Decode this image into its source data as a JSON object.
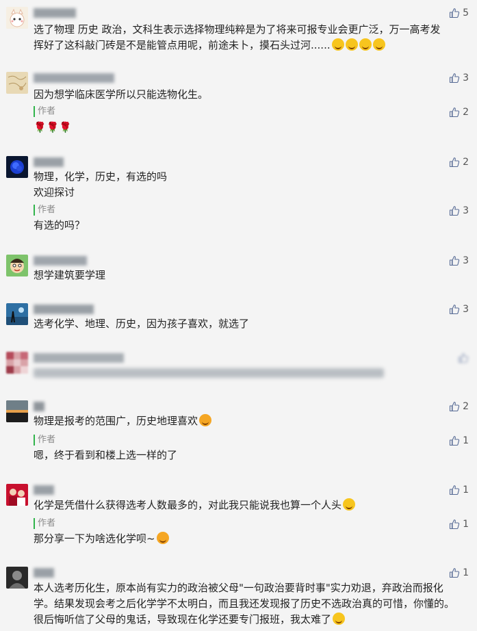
{
  "comments": [
    {
      "avatar": "cat-avatar",
      "likes": "5",
      "text": "选了物理 历史 政治，文科生表示选择物理纯粹是为了将来可报专业会更广泛，万一高考发挥好了这科敲门砖是不是能管点用呢，前途未卜，摸石头过河......",
      "emojis": [
        "crying-emoji",
        "crying-emoji",
        "laughing-emoji",
        "laughing-emoji"
      ]
    },
    {
      "avatar": "map-avatar",
      "likes": "3",
      "text": "因为想学临床医学所以只能选物化生。",
      "reply": {
        "tag": "作者",
        "likes": "2",
        "text": "🌹🌹🌹"
      }
    },
    {
      "avatar": "blue-rose-avatar",
      "likes": "2",
      "text": "物理，化学，历史，有选的吗\n欢迎探讨",
      "reply": {
        "tag": "作者",
        "likes": "3",
        "text": "有选的吗？"
      }
    },
    {
      "avatar": "cartoon-avatar",
      "likes": "3",
      "text": "想学建筑要学理"
    },
    {
      "avatar": "landscape-avatar",
      "likes": "3",
      "text": "选考化学、地理、历史，因为孩子喜欢，就选了"
    },
    {
      "avatar": "pixel-avatar",
      "likes": "",
      "text": "",
      "blurred": true
    },
    {
      "avatar": "sunset-avatar",
      "likes": "2",
      "text": "物理是报考的范围广，历史地理喜欢",
      "emojis": [
        "heart-eyes-emoji"
      ],
      "reply": {
        "tag": "作者",
        "likes": "1",
        "text": "嗯，终于看到和楼上选一样的了"
      }
    },
    {
      "avatar": "red-avatar",
      "likes": "1",
      "text": "化学是凭借什么获得选考人数最多的，对此我只能说我也算一个人头",
      "emojis": [
        "grin-emoji"
      ],
      "reply": {
        "tag": "作者",
        "likes": "1",
        "text": "那分享一下为啥选化学呗~",
        "emojis": [
          "heart-eyes-emoji"
        ]
      }
    },
    {
      "avatar": "dark-avatar",
      "likes": "1",
      "text": "本人选考历化生，原本尚有实力的政治被父母\"一句政治要背时事\"实力劝退，弃政治而报化学。结果发现会考之后化学学不太明白，而且我还发现报了历史不选政治真的可惜，你懂的。很后悔听信了父母的鬼话，导致现在化学还要专门报班，我太难了",
      "emojis": [
        "sad-emoji"
      ]
    }
  ],
  "colors": {
    "background": "#f4f4f4",
    "author_bar": "#2fb34a",
    "like_icon": "#576b95"
  },
  "icons": {
    "like": "thumbs-up-icon"
  }
}
